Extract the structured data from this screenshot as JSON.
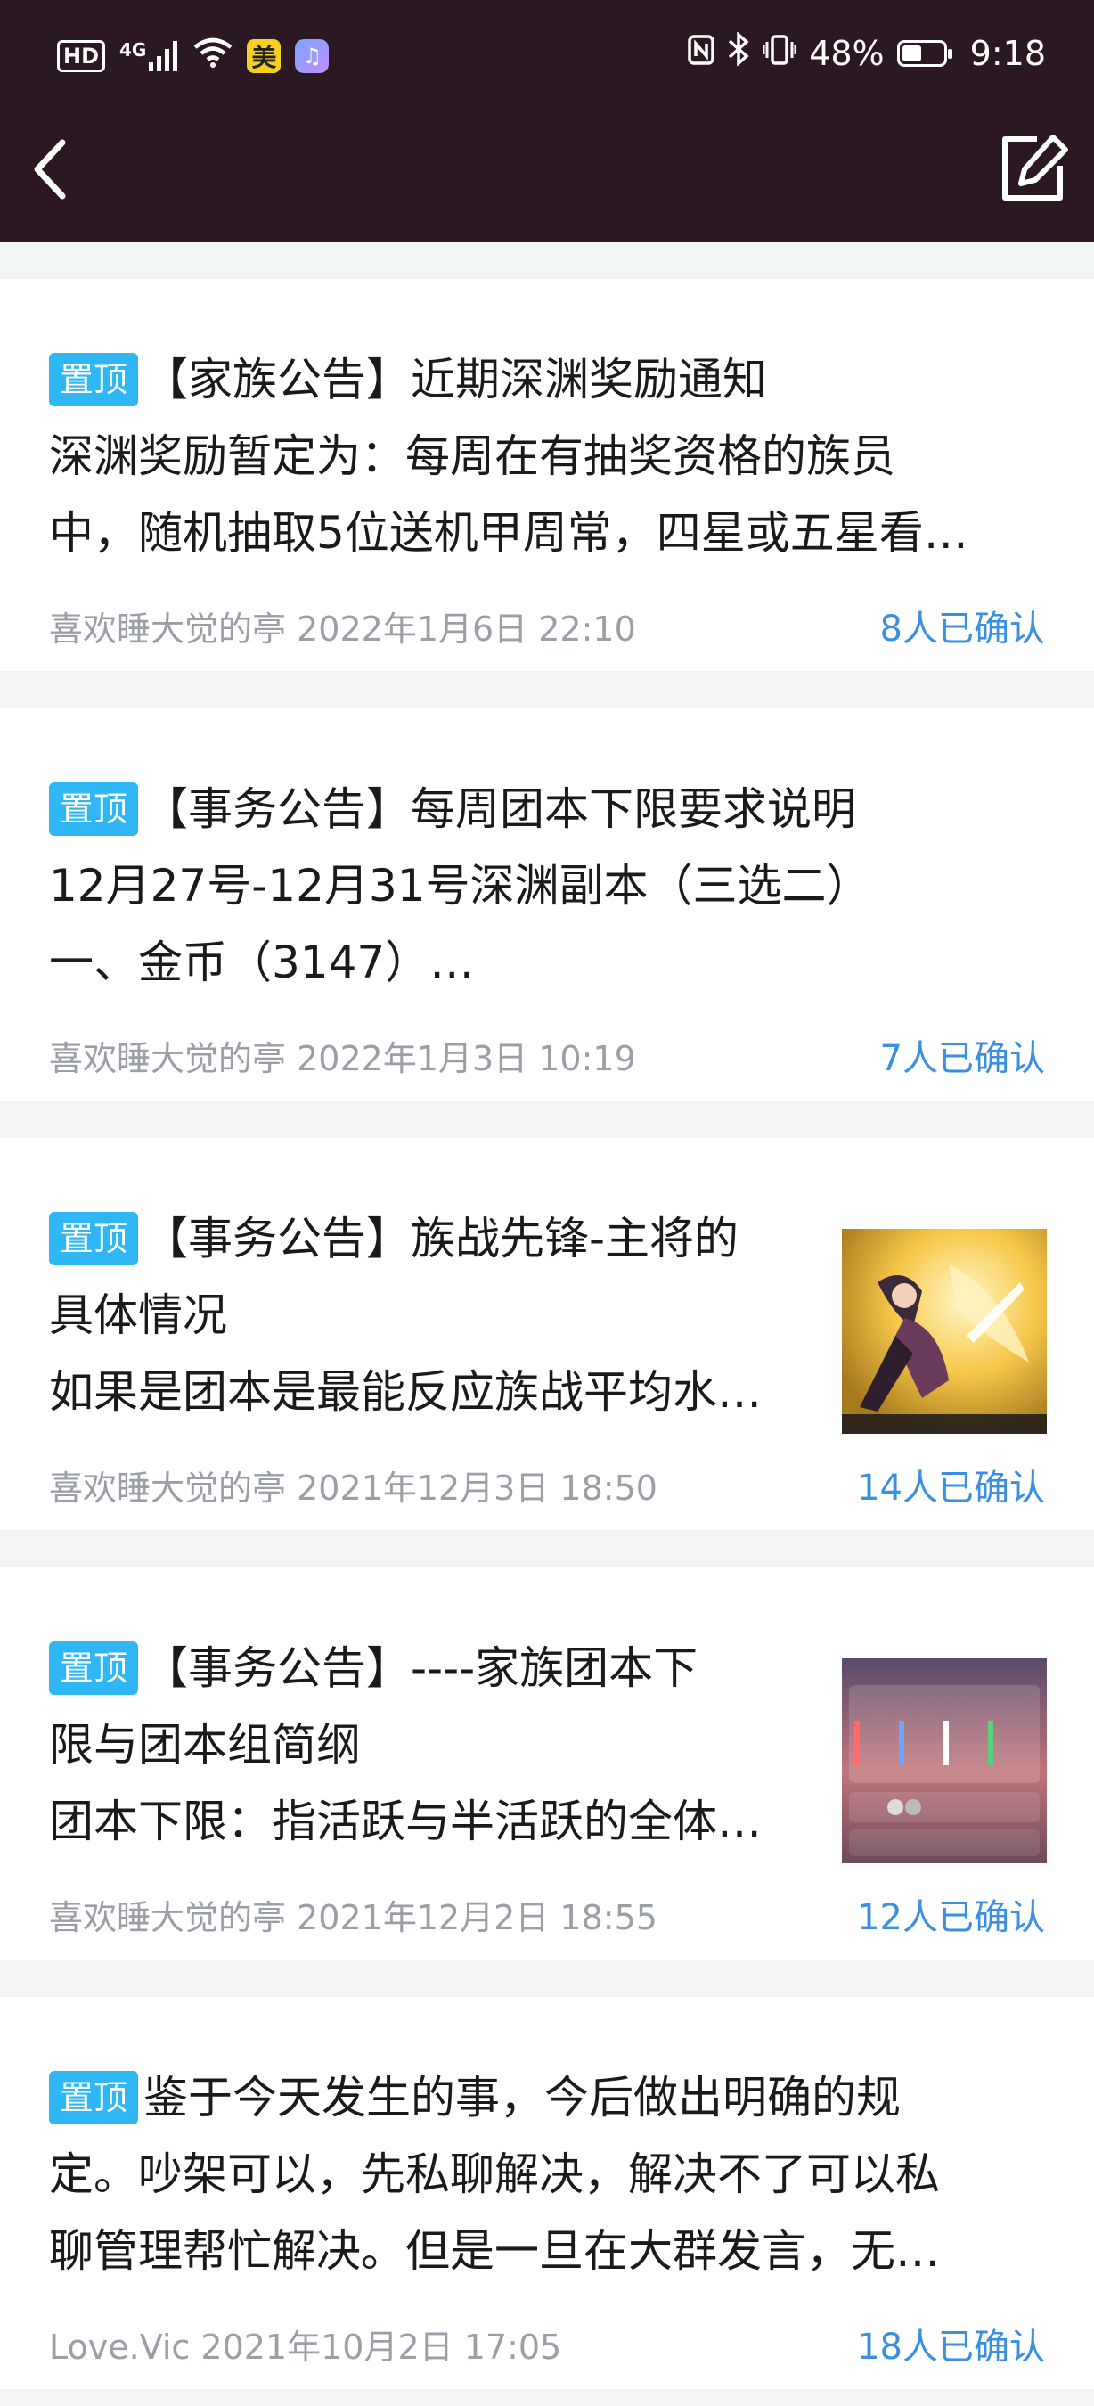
{
  "status_bar": {
    "hd": "HD",
    "network": "4G",
    "app1": "美",
    "app2": "♫",
    "battery_pct_text": "48%",
    "battery_level": 0.48,
    "time": "9:18"
  },
  "posts": [
    {
      "pin": "置顶",
      "lines": [
        "【家族公告】近期深渊奖励通知",
        "深渊奖励暂定为：每周在有抽奖资格的族员",
        "中，随机抽取5位送机甲周常，四星或五星看…"
      ],
      "author": "喜欢睡大觉的亭",
      "time": "2022年1月6日 22:10",
      "confirm": "8人已确认",
      "thumbnail": null
    },
    {
      "pin": "置顶",
      "lines": [
        "【事务公告】每周团本下限要求说明",
        "12月27号-12月31号深渊副本（三选二）",
        "一、金币（3147）…"
      ],
      "author": "喜欢睡大觉的亭",
      "time": "2022年1月3日 10:19",
      "confirm": "7人已确认",
      "thumbnail": null
    },
    {
      "pin": "置顶",
      "lines": [
        "【事务公告】族战先锋-主将的",
        "具体情况",
        "如果是团本是最能反应族战平均水…"
      ],
      "author": "喜欢睡大觉的亭",
      "time": "2021年12月3日 18:50",
      "confirm": "14人已确认",
      "thumbnail": "anime-art"
    },
    {
      "pin": "置顶",
      "lines": [
        "【事务公告】----家族团本下",
        "限与团本组简纲",
        "团本下限：指活跃与半活跃的全体…"
      ],
      "author": "喜欢睡大觉的亭",
      "time": "2021年12月2日 18:55",
      "confirm": "12人已确认",
      "thumbnail": "group-screenshot"
    },
    {
      "pin": "置顶",
      "lines": [
        "鉴于今天发生的事，今后做出明确的规",
        "定。吵架可以，先私聊解决，解决不了可以私",
        "聊管理帮忙解决。但是一旦在大群发言，无…"
      ],
      "author": "Love.Vic",
      "time": "2021年10月2日 17:05",
      "confirm": "18人已确认",
      "thumbnail": null
    }
  ],
  "icons": {
    "back": "chevron-left-icon",
    "edit": "edit-icon"
  }
}
